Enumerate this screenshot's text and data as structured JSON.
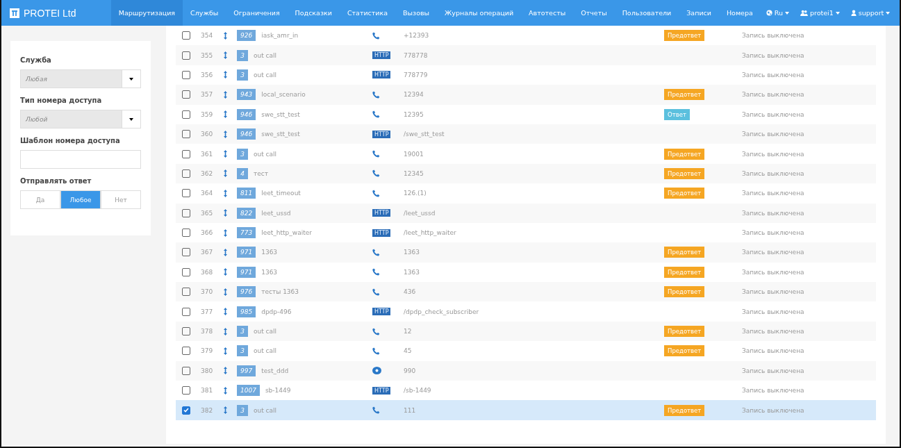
{
  "brand": {
    "name": "PROTEI Ltd"
  },
  "nav": [
    {
      "label": "Маршрутизация",
      "selected": true
    },
    {
      "label": "Службы",
      "selected": false
    },
    {
      "label": "Ограничения",
      "selected": false
    },
    {
      "label": "Подсказки",
      "selected": false
    },
    {
      "label": "Статистика",
      "selected": false
    },
    {
      "label": "Вызовы",
      "selected": false
    },
    {
      "label": "Журналы операций",
      "selected": false
    },
    {
      "label": "Автотесты",
      "selected": false
    },
    {
      "label": "Отчеты",
      "selected": false
    },
    {
      "label": "Пользователи",
      "selected": false
    },
    {
      "label": "Записи",
      "selected": false
    },
    {
      "label": "Номера",
      "selected": false
    }
  ],
  "nav_right": [
    {
      "kind": "globe",
      "label": "Ru"
    },
    {
      "kind": "users",
      "label": "protei1"
    },
    {
      "kind": "user",
      "label": "support"
    }
  ],
  "filters": {
    "service": {
      "label": "Служба",
      "value": "Любая"
    },
    "access_type": {
      "label": "Тип номера доступа",
      "value": "Любой"
    },
    "access_template": {
      "label": "Шаблон номера доступа"
    },
    "send_answer": {
      "label": "Отправлять ответ",
      "options": [
        {
          "label": "Да",
          "selected": false
        },
        {
          "label": "Любое",
          "selected": true
        },
        {
          "label": "Нет",
          "selected": false
        }
      ]
    }
  },
  "rows": [
    {
      "checked": false,
      "id": "354",
      "service_id": "926",
      "name": "iask_amr_in",
      "type": {
        "kind": "phone"
      },
      "number": "+12393",
      "answer": {
        "kind": "preanswer",
        "label": "Предответ"
      },
      "record": "Запись выключена"
    },
    {
      "checked": false,
      "id": "355",
      "service_id": "3",
      "name": "out call",
      "type": {
        "kind": "http",
        "label": "HTTP"
      },
      "number": "778778",
      "record": "Запись выключена"
    },
    {
      "checked": false,
      "id": "356",
      "service_id": "3",
      "name": "out call",
      "type": {
        "kind": "http",
        "label": "HTTP"
      },
      "number": "778779",
      "record": "Запись выключена"
    },
    {
      "checked": false,
      "id": "357",
      "service_id": "943",
      "name": "local_scenario",
      "type": {
        "kind": "phone"
      },
      "number": "12394",
      "answer": {
        "kind": "preanswer",
        "label": "Предответ"
      },
      "record": "Запись выключена"
    },
    {
      "checked": false,
      "id": "359",
      "service_id": "946",
      "name": "swe_stt_test",
      "type": {
        "kind": "phone"
      },
      "number": "12395",
      "answer": {
        "kind": "answer",
        "label": "Ответ"
      },
      "record": "Запись выключена"
    },
    {
      "checked": false,
      "id": "360",
      "service_id": "946",
      "name": "swe_stt_test",
      "type": {
        "kind": "http",
        "label": "HTTP"
      },
      "number": "/swe_stt_test",
      "record": "Запись выключена"
    },
    {
      "checked": false,
      "id": "361",
      "service_id": "3",
      "name": "out call",
      "type": {
        "kind": "phone"
      },
      "number": "19001",
      "answer": {
        "kind": "preanswer",
        "label": "Предответ"
      },
      "record": "Запись выключена"
    },
    {
      "checked": false,
      "id": "362",
      "service_id": "4",
      "name": "тест",
      "type": {
        "kind": "phone"
      },
      "number": "12345",
      "answer": {
        "kind": "preanswer",
        "label": "Предответ"
      },
      "record": "Запись выключена"
    },
    {
      "checked": false,
      "id": "364",
      "service_id": "811",
      "name": "leet_timeout",
      "type": {
        "kind": "phone"
      },
      "number": "126.(1)",
      "answer": {
        "kind": "preanswer",
        "label": "Предответ"
      },
      "record": "Запись выключена"
    },
    {
      "checked": false,
      "id": "365",
      "service_id": "822",
      "name": "leet_ussd",
      "type": {
        "kind": "http",
        "label": "HTTP"
      },
      "number": "/leet_ussd",
      "record": "Запись выключена"
    },
    {
      "checked": false,
      "id": "366",
      "service_id": "773",
      "name": "leet_http_waiter",
      "type": {
        "kind": "http",
        "label": "HTTP"
      },
      "number": "/leet_http_waiter",
      "record": "Запись выключена"
    },
    {
      "checked": false,
      "id": "367",
      "service_id": "971",
      "name": "1363",
      "type": {
        "kind": "phone"
      },
      "number": "1363",
      "answer": {
        "kind": "preanswer",
        "label": "Предответ"
      },
      "record": "Запись выключена"
    },
    {
      "checked": false,
      "id": "368",
      "service_id": "971",
      "name": "1363",
      "type": {
        "kind": "phone"
      },
      "number": "1363",
      "answer": {
        "kind": "preanswer",
        "label": "Предответ"
      },
      "record": "Запись выключена"
    },
    {
      "checked": false,
      "id": "370",
      "service_id": "976",
      "name": "тесты 1363",
      "type": {
        "kind": "phone"
      },
      "number": "436",
      "answer": {
        "kind": "preanswer",
        "label": "Предответ"
      },
      "record": "Запись выключена"
    },
    {
      "checked": false,
      "id": "377",
      "service_id": "985",
      "name": "dpdp-496",
      "type": {
        "kind": "http",
        "label": "HTTP"
      },
      "number": "/dpdp_check_subscriber",
      "record": "Запись выключена"
    },
    {
      "checked": false,
      "id": "378",
      "service_id": "3",
      "name": "out call",
      "type": {
        "kind": "phone"
      },
      "number": "12",
      "answer": {
        "kind": "preanswer",
        "label": "Предответ"
      },
      "record": "Запись выключена"
    },
    {
      "checked": false,
      "id": "379",
      "service_id": "3",
      "name": "out call",
      "type": {
        "kind": "phone"
      },
      "number": "45",
      "answer": {
        "kind": "preanswer",
        "label": "Предответ"
      },
      "record": "Запись выключена"
    },
    {
      "checked": false,
      "id": "380",
      "service_id": "997",
      "name": "test_ddd",
      "type": {
        "kind": "eye"
      },
      "number": "990",
      "record": "Запись выключена"
    },
    {
      "checked": false,
      "id": "381",
      "service_id": "1007",
      "name": "sb-1449",
      "type": {
        "kind": "http",
        "label": "HTTP"
      },
      "number": "/sb-1449",
      "record": "Запись выключена"
    },
    {
      "checked": true,
      "id": "382",
      "service_id": "3",
      "name": "out call",
      "type": {
        "kind": "phone"
      },
      "number": "111",
      "answer": {
        "kind": "preanswer",
        "label": "Предответ"
      },
      "record": "Запись выключена"
    }
  ]
}
